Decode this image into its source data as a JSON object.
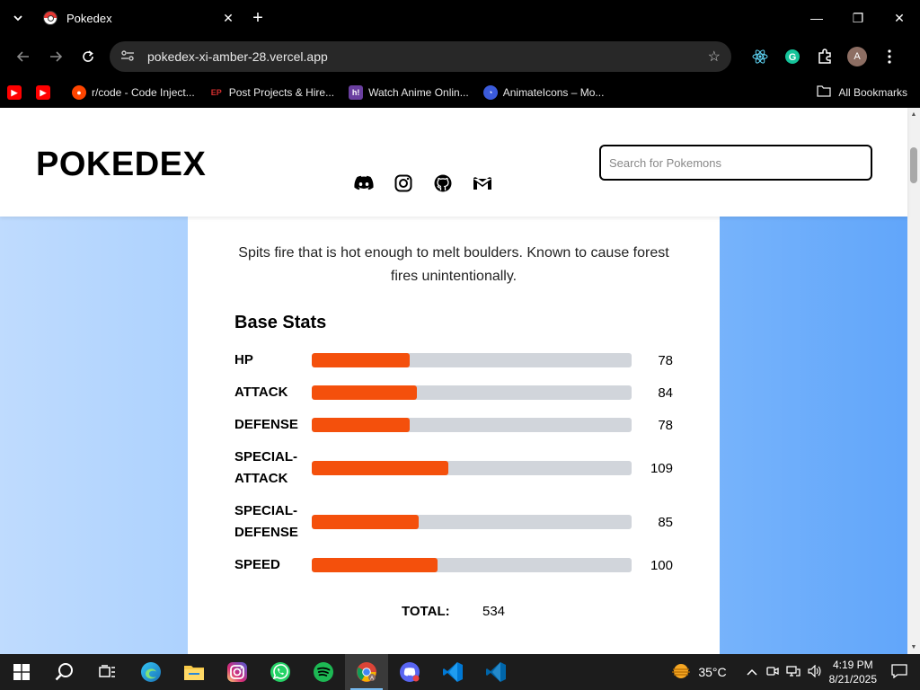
{
  "browser": {
    "tab_title": "Pokedex",
    "url": "pokedex-xi-amber-28.vercel.app",
    "bookmarks": [
      {
        "label": "",
        "icon": "youtube-icon",
        "color": "#ff0000"
      },
      {
        "label": "",
        "icon": "youtube-icon",
        "color": "#ff0000"
      },
      {
        "label": "r/code - Code Inject...",
        "icon": "reddit-icon",
        "color": "#ff4500"
      },
      {
        "label": "Post Projects & Hire...",
        "icon": "ep-icon",
        "color": "#d32f2f"
      },
      {
        "label": "Watch Anime Onlin...",
        "icon": "hianime-icon",
        "color": "#6a3fa0"
      },
      {
        "label": "AnimateIcons – Mo...",
        "icon": "animateicons-icon",
        "color": "#3b5bdb"
      }
    ],
    "all_bookmarks": "All Bookmarks",
    "avatar_letter": "A"
  },
  "header": {
    "logo": "POKEDEX",
    "search_placeholder": "Search for Pokemons"
  },
  "pokemon": {
    "description": "Spits fire that is hot enough to melt boulders. Known to cause forest fires unintentionally.",
    "stats_title": "Base Stats",
    "stats": [
      {
        "name": "HP",
        "value": "78",
        "fraction": 0.307
      },
      {
        "name": "ATTACK",
        "value": "84",
        "fraction": 0.329
      },
      {
        "name": "DEFENSE",
        "value": "78",
        "fraction": 0.307
      },
      {
        "name": "SPECIAL-ATTACK",
        "value": "109",
        "fraction": 0.427
      },
      {
        "name": "SPECIAL-DEFENSE",
        "value": "85",
        "fraction": 0.334
      },
      {
        "name": "SPEED",
        "value": "100",
        "fraction": 0.393
      }
    ],
    "total_label": "TOTAL:",
    "total_value": "534",
    "bar_color": "#f4500c"
  },
  "taskbar": {
    "weather": "35°C",
    "time": "4:19 PM",
    "date": "8/21/2025"
  }
}
